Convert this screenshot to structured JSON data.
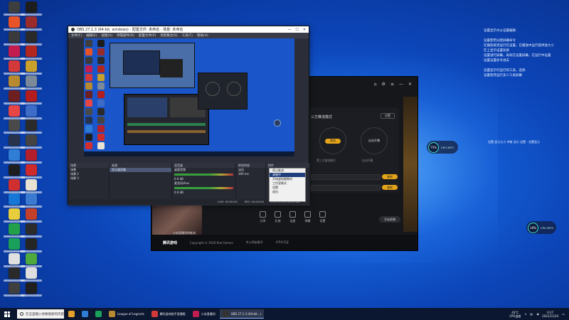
{
  "desktop": {
    "icon_colors": [
      "#3e3e3e",
      "#1d1d1d",
      "#e85427",
      "#9a2b2b",
      "#3a3a3a",
      "#2a2a2a",
      "#c21d4e",
      "#b1261f",
      "#d33939",
      "#c8a02b",
      "#b88a2f",
      "#7a8a98",
      "#6e1f1f",
      "#b31d1d",
      "#e84545",
      "#3d6cc8",
      "#4a4a4a",
      "#2b2b2b",
      "#27324b",
      "#444444",
      "#2f7dd4",
      "#b31f2a",
      "#1e1e1e",
      "#cd2a2a",
      "#d12f2f",
      "#eae3d3",
      "#1677d6",
      "#3a7ad1",
      "#e8cd3c",
      "#c23f2a",
      "#22a04a",
      "#2c2c2c",
      "#1aa05a",
      "#252525",
      "#e0e0e0",
      "#4eaa3c",
      "#2a2a2a",
      "#dedede",
      "#3f3f3f",
      "#1f1f1f"
    ]
  },
  "right_notes": {
    "lines_a": [
      "设置显示水从设置编辑",
      "",
      "设置使用分配屏幕命令",
      "在播放取消运行在设置，在播放中运行提供放大小",
      "在上显示设置效果",
      "设置进行屏幕，再效在设置屏幕，在运行中设置",
      "设置设置命令进去",
      "",
      "设置显示行运行的工具，选择",
      "设置程序运行多少工具屏幕"
    ],
    "lines_b": [
      "设置 显示大小 中取 显示 设置 - 设置显示"
    ]
  },
  "obs": {
    "title": "OBS 27.1.3 (64-bit, windows) - 配置文件: 未命名 - 场景: 未命名",
    "menu": [
      "文件(F)",
      "编辑(E)",
      "视图(V)",
      "停靠部件(D)",
      "配置文件(P)",
      "场景集合(S)",
      "工具(T)",
      "帮助(H)"
    ],
    "docks": {
      "scenes_header": "场景",
      "scenes": [
        "场景",
        "场景 2",
        "场景 3"
      ],
      "sources_header": "来源",
      "sources": [
        "显示器采集"
      ],
      "mixer_header": "混音器",
      "mixer_tracks": [
        {
          "name": "桌面音频",
          "level": "0.0 dB"
        },
        {
          "name": "麦克风/Aux",
          "level": "0.0 dB"
        }
      ],
      "transitions_header": "转场特效",
      "transitions": [
        "淡出",
        "300 ms"
      ],
      "controls_header": "控件"
    },
    "context_menu": [
      "停止推流",
      "录制中",
      "开始虚拟摄像机",
      "工作室模式",
      "设置",
      "退出"
    ],
    "status": [
      "LIVE: 00:00:00",
      "REC: 00:00:00",
      "CPU: 1.9%, 30.00 fps"
    ]
  },
  "tencent": {
    "panel_title": "三方推流模式",
    "panel_btn": "设置",
    "circle_a": "推流",
    "circle_b": "自动开播",
    "circle_a_desc": "第三方推流模式",
    "circle_b_desc": "自动开播",
    "pill_a": "复制",
    "pill_b": "复制",
    "tool_labels": [
      "分享",
      "礼物",
      "连麦",
      "弹幕",
      "设置"
    ],
    "footer": [
      "腾讯游戏",
      "Copyright © 2020 Riot Games",
      "京公网安备号",
      "ICP许可证"
    ],
    "record_label": "开始直播",
    "thumb_label": "小米直播间的推流",
    "dark_label": "直播间"
  },
  "floats": {
    "a_value": "75%",
    "a_text": "CPU 38°C",
    "b_value": "18%",
    "b_text": "CPU 36°C"
  },
  "taskbar": {
    "search_placeholder": "在这里输入你要搜索的内容",
    "apps": [
      {
        "label": "",
        "color": "#e6a12a"
      },
      {
        "label": "",
        "color": "#2f7dd4"
      },
      {
        "label": "",
        "color": "#1aa05a"
      },
      {
        "label": "League of Legends",
        "color": "#b88a2f"
      },
      {
        "label": "腾讯游戏助手直播版",
        "color": "#d33939"
      },
      {
        "label": "小米直播间",
        "color": "#c21d4e"
      },
      {
        "label": "OBS 27.1.3 (64-bit...)",
        "color": "#333333",
        "active": true
      }
    ],
    "cpu_label": "43°C",
    "cpu_sub": "CPU温度",
    "time": "9:17",
    "date": "2021/11/24"
  }
}
